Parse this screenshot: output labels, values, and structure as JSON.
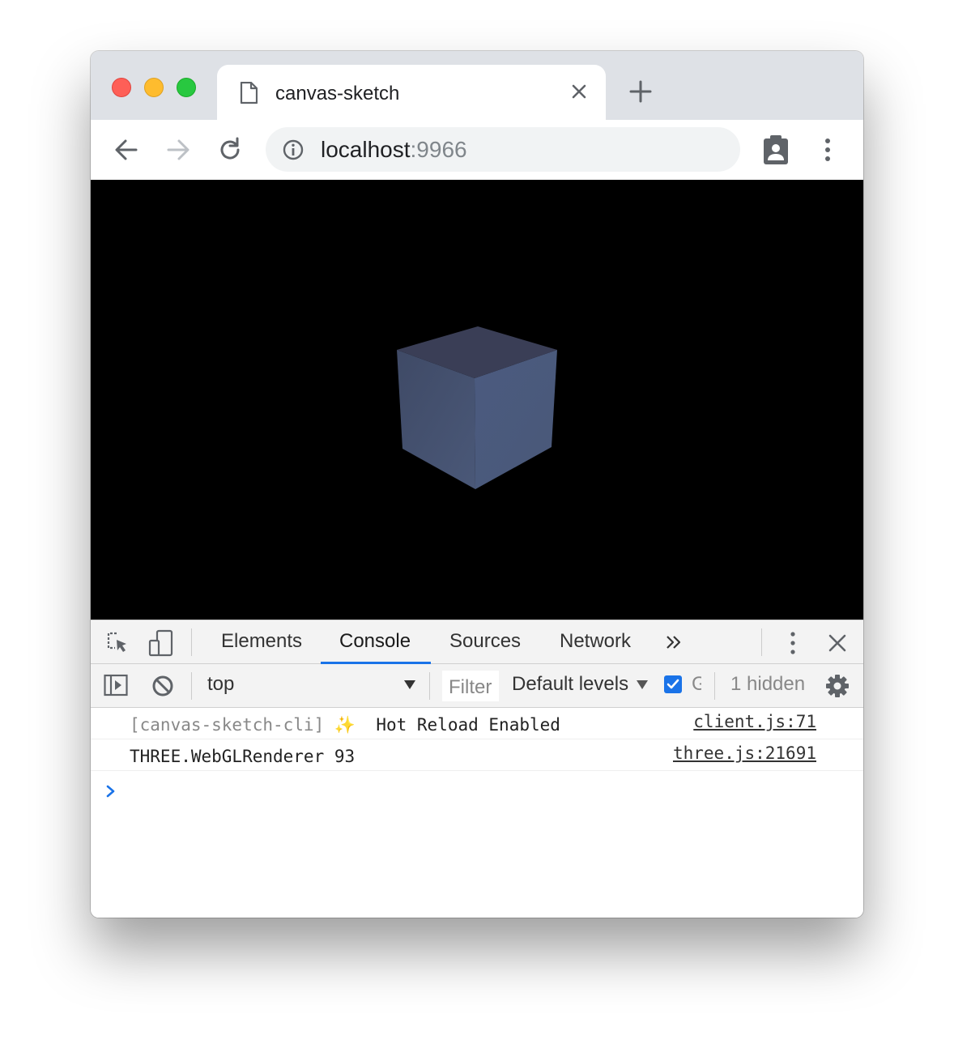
{
  "tab": {
    "title": "canvas-sketch"
  },
  "omnibox": {
    "host": "localhost",
    "port": ":9966"
  },
  "devtools": {
    "tabs": [
      {
        "label": "Elements"
      },
      {
        "label": "Console"
      },
      {
        "label": "Sources"
      },
      {
        "label": "Network"
      }
    ],
    "active_tab": "Console",
    "console_bar": {
      "context": "top",
      "filter_placeholder": "Filter",
      "levels": "Default levels",
      "hidden": "1 hidden"
    },
    "messages": [
      {
        "prefix": "[canvas-sketch-cli]",
        "sparkle": "✨",
        "text": "Hot Reload Enabled",
        "source": "client.js:71"
      },
      {
        "prefix": "",
        "sparkle": "",
        "text": "THREE.WebGLRenderer 93",
        "source": "three.js:21691"
      }
    ]
  },
  "colors": {
    "accent": "#1a73e8",
    "cube_top": "#3a3e56",
    "cube_left": "#445270",
    "cube_right": "#4a5a7e"
  },
  "icons": [
    "document-icon",
    "close-icon",
    "plus-icon",
    "back-arrow-icon",
    "forward-arrow-icon",
    "reload-icon",
    "info-icon",
    "clipboard-account-icon",
    "kebab-menu-icon",
    "inspect-element-icon",
    "device-toggle-icon",
    "chevrons-right-icon",
    "sidebar-toggle-icon",
    "clear-console-icon",
    "gear-icon",
    "prompt-chevron-icon"
  ]
}
